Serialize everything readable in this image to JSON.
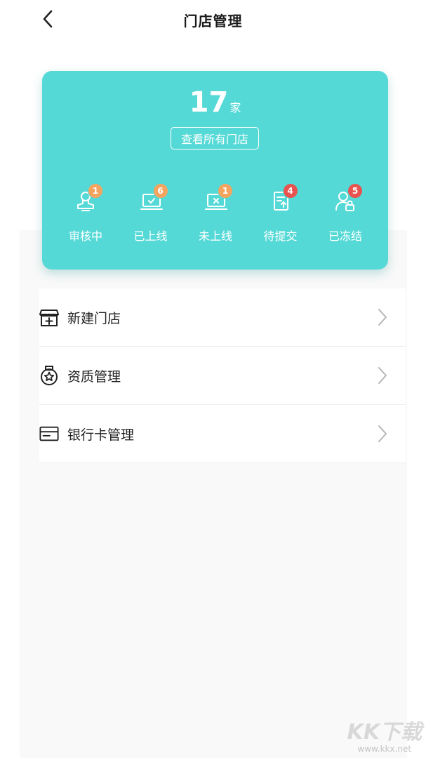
{
  "header": {
    "title": "门店管理"
  },
  "summary": {
    "count": "17",
    "unit": "家",
    "view_all_label": "查看所有门店"
  },
  "statuses": [
    {
      "label": "审核中",
      "badge": "1",
      "badge_color": "#f4a45f"
    },
    {
      "label": "已上线",
      "badge": "6",
      "badge_color": "#f4a45f"
    },
    {
      "label": "未上线",
      "badge": "1",
      "badge_color": "#f4a45f"
    },
    {
      "label": "待提交",
      "badge": "4",
      "badge_color": "#e8534f"
    },
    {
      "label": "已冻结",
      "badge": "5",
      "badge_color": "#e8534f"
    }
  ],
  "menu": [
    {
      "label": "新建门店",
      "icon": "store-plus-icon"
    },
    {
      "label": "资质管理",
      "icon": "medal-star-icon"
    },
    {
      "label": "银行卡管理",
      "icon": "bank-card-icon"
    }
  ],
  "watermark": {
    "main": "KK下载",
    "sub": "www.kkx.net"
  },
  "colors": {
    "accent": "#55d9d6",
    "badge_orange": "#f4a45f",
    "badge_red": "#e8534f"
  }
}
